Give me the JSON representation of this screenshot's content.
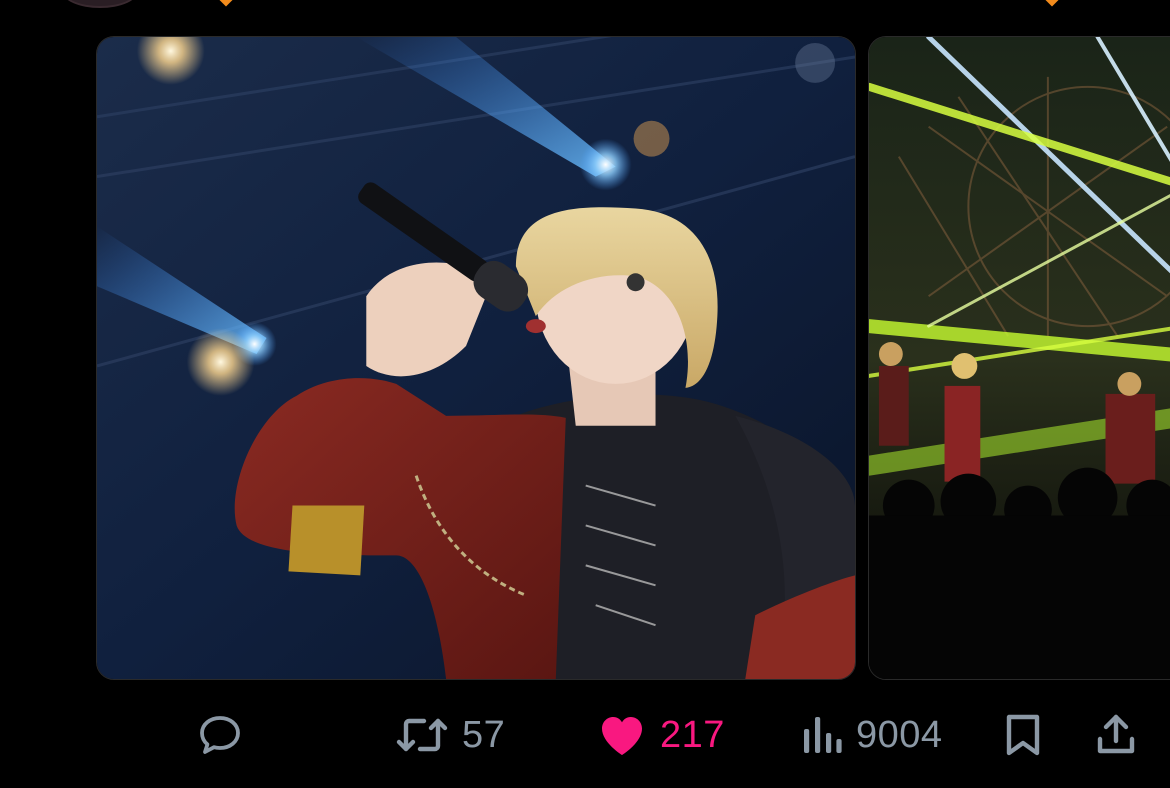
{
  "tweet": {
    "media": [
      {
        "name": "concert-photo-vocalist",
        "kind": "photo"
      },
      {
        "name": "concert-photo-stage-lasers",
        "kind": "photo"
      }
    ],
    "actions": {
      "reply": {
        "icon": "reply-icon",
        "count": null
      },
      "retweet": {
        "icon": "retweet-icon",
        "count": "57"
      },
      "like": {
        "icon": "heart-icon",
        "count": "217",
        "liked": true
      },
      "views": {
        "icon": "views-icon",
        "count": "9004"
      },
      "bookmark": {
        "icon": "bookmark-icon",
        "count": null
      },
      "share": {
        "icon": "share-icon",
        "count": null
      }
    }
  },
  "colors": {
    "background": "#000000",
    "icon_default": "#8b98a5",
    "like_accent": "#f91880",
    "verified_badge": "#f28b1c"
  }
}
